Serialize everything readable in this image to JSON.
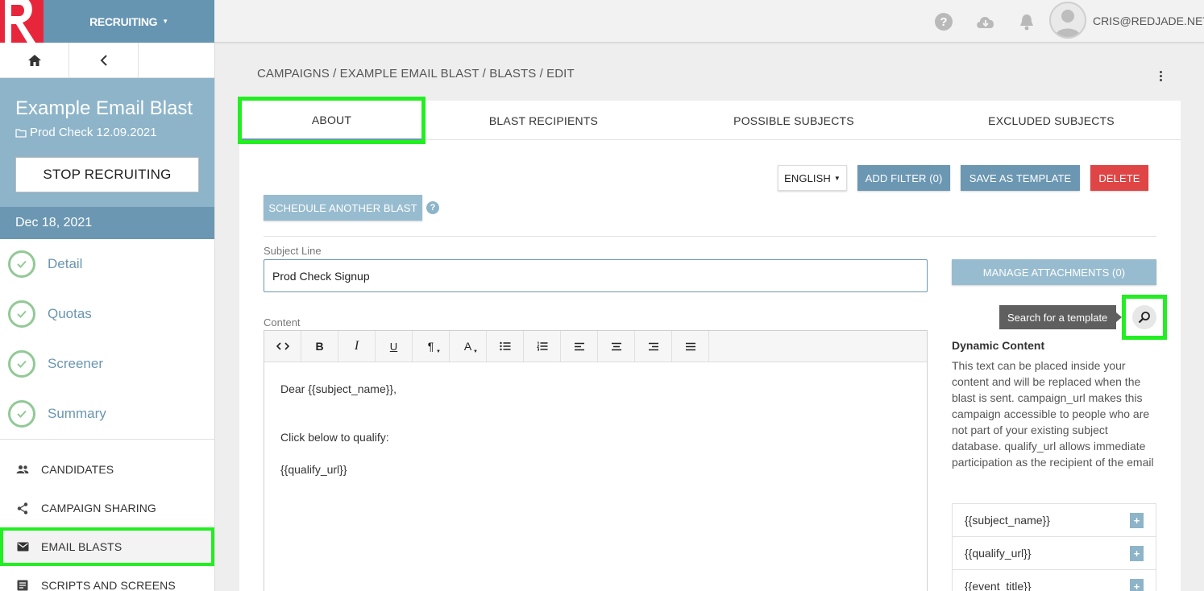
{
  "colors": {
    "accent": "#6b97b2",
    "brand_red": "#e8263b",
    "highlight": "#22ee22",
    "check_green": "#92c996"
  },
  "topbar": {
    "menu_label": "RECRUITING",
    "user_email": "CRIS@REDJADE.NET"
  },
  "sidebar": {
    "title": "Example Email Blast",
    "folder": "Prod Check 12.09.2021",
    "stop_label": "STOP RECRUITING",
    "date": "Dec 18, 2021",
    "steps": [
      {
        "label": "Detail"
      },
      {
        "label": "Quotas"
      },
      {
        "label": "Screener"
      },
      {
        "label": "Summary"
      }
    ],
    "links": [
      {
        "label": "CANDIDATES",
        "icon": "people-icon"
      },
      {
        "label": "CAMPAIGN SHARING",
        "icon": "share-icon"
      },
      {
        "label": "EMAIL BLASTS",
        "icon": "mail-icon"
      },
      {
        "label": "SCRIPTS AND SCREENS",
        "icon": "document-icon"
      }
    ]
  },
  "breadcrumb": "CAMPAIGNS / EXAMPLE EMAIL BLAST / BLASTS / EDIT",
  "tabs": [
    {
      "label": "ABOUT"
    },
    {
      "label": "BLAST RECIPIENTS"
    },
    {
      "label": "POSSIBLE SUBJECTS"
    },
    {
      "label": "EXCLUDED SUBJECTS"
    }
  ],
  "actions": {
    "language": "ENGLISH",
    "add_filter": "ADD FILTER (0)",
    "save_template": "SAVE AS TEMPLATE",
    "delete": "DELETE",
    "schedule": "SCHEDULE ANOTHER BLAST",
    "manage_attachments": "MANAGE ATTACHMENTS (0)"
  },
  "form": {
    "subject_label": "Subject Line",
    "subject_value": "Prod Check Signup",
    "content_label": "Content",
    "content_lines": [
      "Dear {{subject_name}},",
      "Click below to qualify:",
      "{{qualify_url}}"
    ]
  },
  "template_search": {
    "tooltip": "Search for a template"
  },
  "dynamic": {
    "title": "Dynamic Content",
    "description": "This text can be placed inside your content and will be replaced when the blast is sent. campaign_url makes this campaign accessible to people who are not part of your existing subject database. qualify_url allows immediate participation as the recipient of the email",
    "items": [
      "{{subject_name}}",
      "{{qualify_url}}",
      "{{event_title}}"
    ],
    "add_symbol": "+"
  }
}
